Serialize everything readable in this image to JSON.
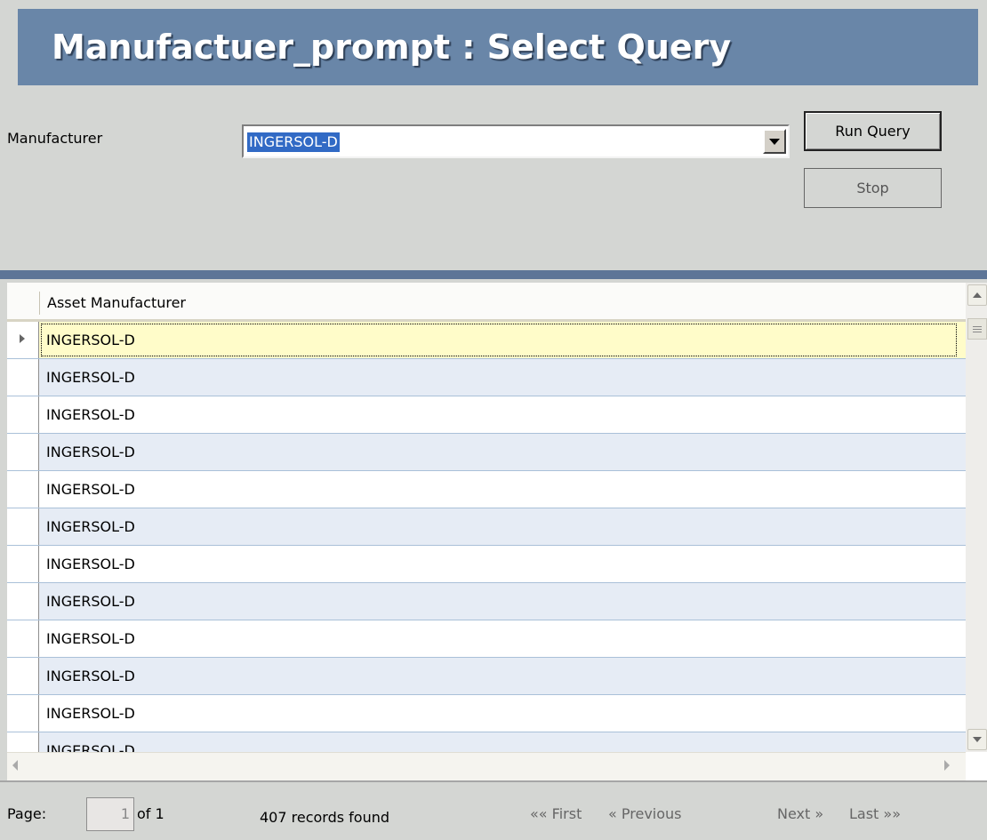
{
  "title": "Manufactuer_prompt : Select Query",
  "prompt": {
    "label": "Manufacturer",
    "value": "INGERSOL-D"
  },
  "buttons": {
    "run": "Run Query",
    "stop": "Stop"
  },
  "grid": {
    "column": "Asset Manufacturer",
    "rows": [
      "INGERSOL-D",
      "INGERSOL-D",
      "INGERSOL-D",
      "INGERSOL-D",
      "INGERSOL-D",
      "INGERSOL-D",
      "INGERSOL-D",
      "INGERSOL-D",
      "INGERSOL-D",
      "INGERSOL-D",
      "INGERSOL-D",
      "INGERSOL-D"
    ]
  },
  "pager": {
    "page_label": "Page:",
    "page_value": "1",
    "of_label": "of 1",
    "records": "407 records found",
    "first": "«« First",
    "previous": "« Previous",
    "next": "Next »",
    "last": "Last »»"
  }
}
